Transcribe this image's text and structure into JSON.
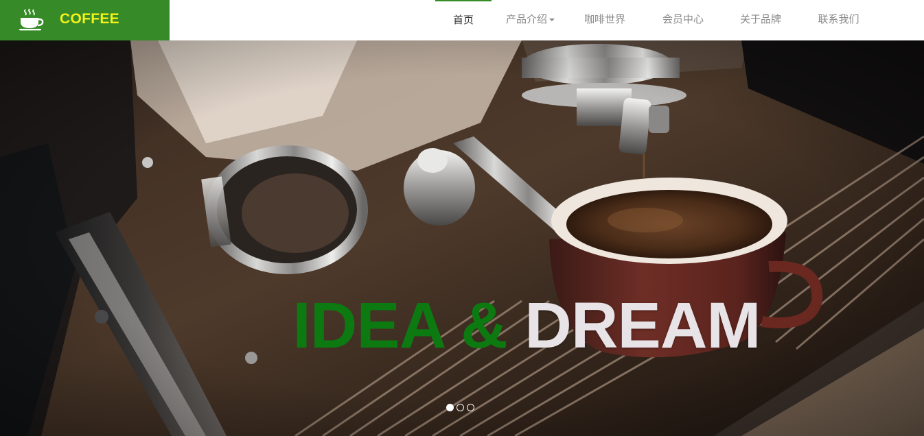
{
  "brand": {
    "name": "COFFEE",
    "icon": "coffee-cup-icon",
    "colors": {
      "background": "#368a27",
      "text": "#f3f21a"
    }
  },
  "nav": {
    "items": [
      {
        "label": "首页",
        "active": true
      },
      {
        "label": "产品介绍",
        "dropdown": true,
        "icon": "caret-down-icon"
      },
      {
        "label": "咖啡世界"
      },
      {
        "label": "会员中心"
      },
      {
        "label": "关于品牌"
      },
      {
        "label": "联系我们"
      }
    ],
    "colors": {
      "active_text": "#333333",
      "inactive_text": "#8a8a8a",
      "active_indicator": "#368a27"
    }
  },
  "hero": {
    "image": "espresso-machine-photo",
    "headline": {
      "part1": "IDEA & ",
      "part2": "DREAM"
    },
    "colors": {
      "part1": "#0c7a10",
      "part2": "#e8e3e6"
    },
    "carousel": {
      "slide_count": 3,
      "active_index": 0
    }
  }
}
